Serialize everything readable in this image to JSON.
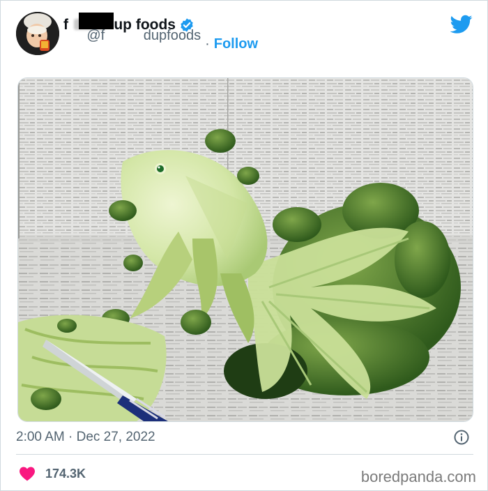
{
  "tweet": {
    "display_name": "f        d up foods",
    "handle": "@f          dupfoods",
    "separator": "·",
    "follow_label": "Follow",
    "timestamp": "2:00 AM · Dec 27, 2022",
    "likes": "174.3K"
  },
  "icons": {
    "verified": "verified-badge-icon",
    "logo": "twitter-bird-icon",
    "info": "info-icon",
    "like": "heart-icon"
  },
  "colors": {
    "accent": "#1d9bf0",
    "like": "#f91880",
    "text_secondary": "#536471",
    "divider": "#cfd9de"
  },
  "watermark": "boredpanda.com"
}
